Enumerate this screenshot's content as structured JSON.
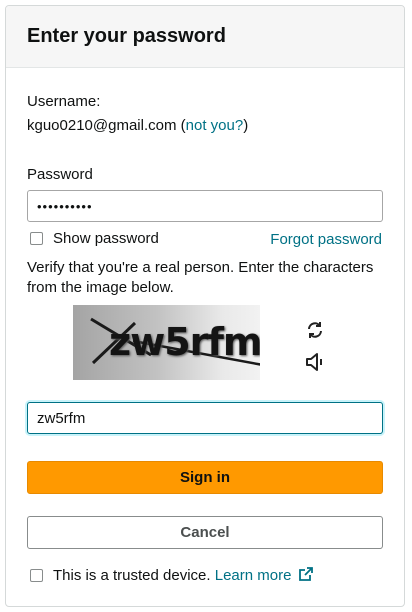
{
  "header": {
    "title": "Enter your password"
  },
  "account": {
    "username_label": "Username:",
    "email": "kguo0210@gmail.com",
    "open_paren": "(",
    "not_you_link": "not you?",
    "close_paren": ")"
  },
  "password": {
    "label": "Password",
    "masked_value": "••••••••••"
  },
  "show_password": {
    "label": "Show password",
    "checked": false
  },
  "forgot_password_link": "Forgot password",
  "captcha": {
    "instructions": "Verify that you're a real person. Enter the characters from the image below.",
    "image_text": "zw5rfm",
    "refresh_icon": "refresh-icon",
    "audio_icon": "speaker-audio-icon",
    "input_value": "zw5rfm"
  },
  "buttons": {
    "sign_in": "Sign in",
    "cancel": "Cancel"
  },
  "trusted_device": {
    "label": "This is a trusted device.",
    "learn_more_link": "Learn more",
    "external_icon": "external-link-icon",
    "checked": false
  },
  "colors": {
    "primary_button": "#ff9900",
    "link": "#007185",
    "focus_border": "#007185"
  }
}
